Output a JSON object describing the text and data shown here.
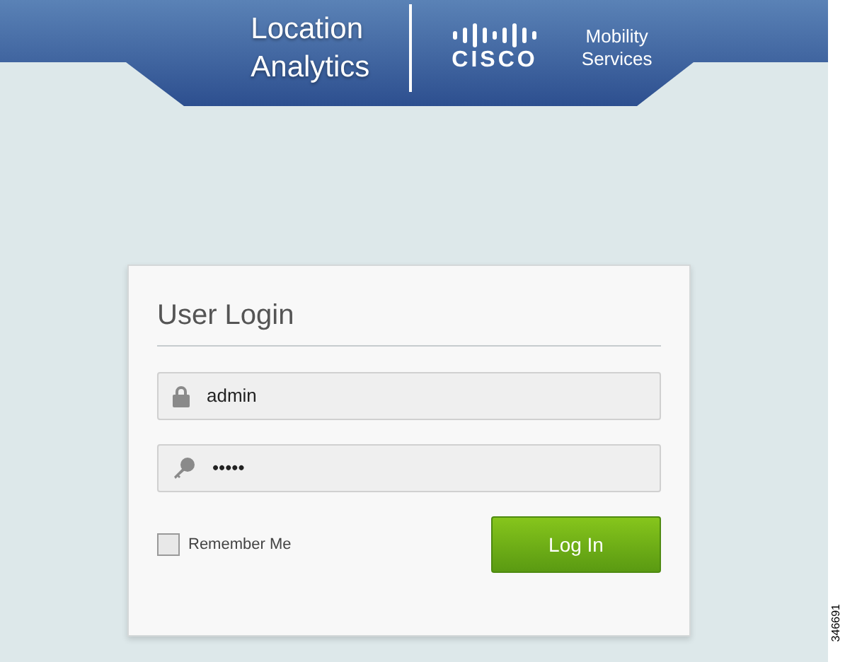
{
  "header": {
    "product_lines": [
      "Location",
      "Analytics"
    ],
    "logo_word": "CISCO",
    "subtitle": "Mobility Services"
  },
  "login": {
    "title": "User Login",
    "fields": [
      {
        "kind": "user",
        "value": "admin"
      },
      {
        "kind": "password",
        "value": "•••••"
      }
    ],
    "remember": {
      "label": "Remember Me",
      "checked": false
    },
    "button": "Log In"
  },
  "figure_number": "346691"
}
